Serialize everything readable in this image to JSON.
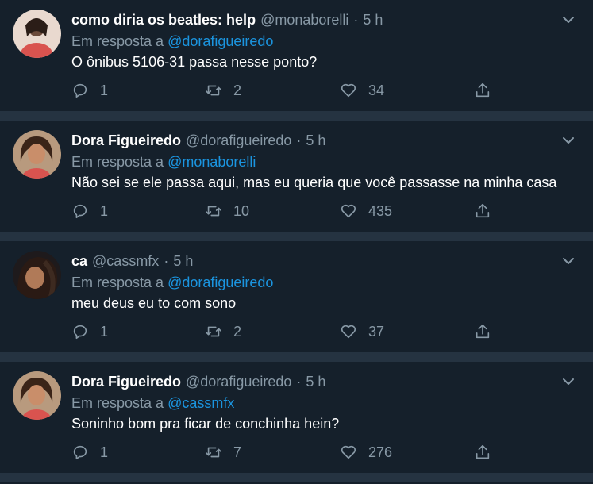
{
  "reply_prefix": "Em resposta a",
  "separator": "·",
  "colors": {
    "background": "#15202b",
    "divider": "#253341",
    "secondary_text": "#8899a6",
    "mention": "#1b95e0"
  },
  "tweets": [
    {
      "display_name": "como diria os beatles: help",
      "handle": "@monaborelli",
      "time": "5 h",
      "reply_to": "@dorafigueiredo",
      "text": "O ônibus 5106-31 passa nesse ponto?",
      "replies": "1",
      "retweets": "2",
      "likes": "34"
    },
    {
      "display_name": "Dora Figueiredo",
      "handle": "@dorafigueiredo",
      "time": "5 h",
      "reply_to": "@monaborelli",
      "text": "Não sei se ele passa aqui, mas eu queria que você passasse na minha casa",
      "replies": "1",
      "retweets": "10",
      "likes": "435"
    },
    {
      "display_name": "ca",
      "handle": "@cassmfx",
      "time": "5 h",
      "reply_to": "@dorafigueiredo",
      "text": "meu deus eu to com sono",
      "replies": "1",
      "retweets": "2",
      "likes": "37"
    },
    {
      "display_name": "Dora Figueiredo",
      "handle": "@dorafigueiredo",
      "time": "5 h",
      "reply_to": "@cassmfx",
      "text": "Soninho bom pra ficar de conchinha hein?",
      "replies": "1",
      "retweets": "7",
      "likes": "276"
    }
  ],
  "icons": {
    "reply": "speech-bubble-icon",
    "retweet": "retweet-arrows-icon",
    "like": "heart-outline-icon",
    "share": "share-upload-icon",
    "menu": "chevron-down-icon"
  }
}
